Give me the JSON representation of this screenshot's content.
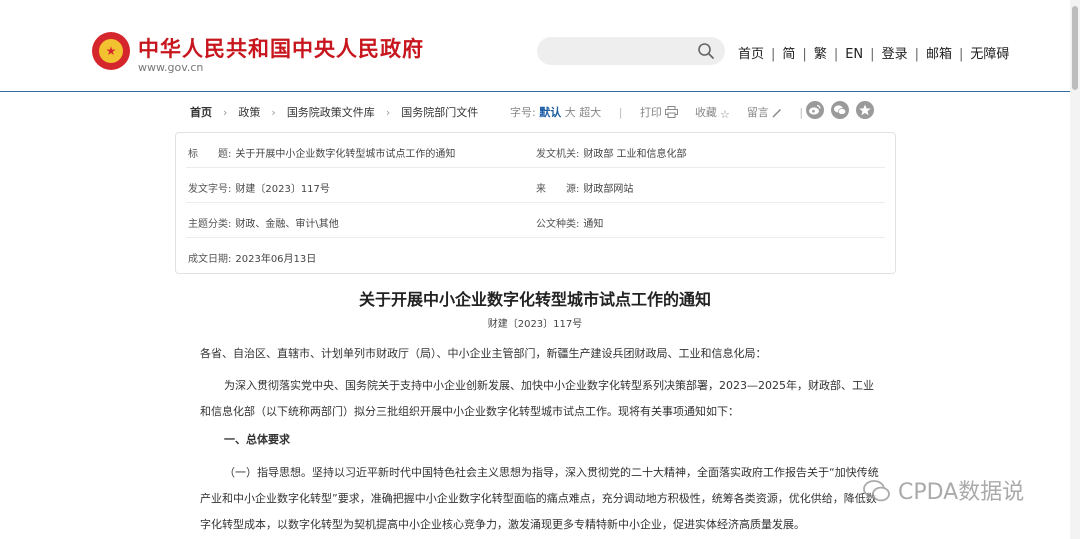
{
  "header": {
    "site_title": "中华人民共和国中央人民政府",
    "site_url": "www.gov.cn",
    "search": {
      "placeholder": ""
    },
    "nav": [
      "首页",
      "简",
      "繁",
      "EN",
      "登录",
      "邮箱",
      "无障碍"
    ],
    "accent_color": "#c8161e"
  },
  "breadcrumb": [
    "首页",
    "政策",
    "国务院政策文件库",
    "国务院部门文件"
  ],
  "tools": {
    "font_size_label": "字号:",
    "font_default": "默认",
    "font_large": "大",
    "font_xlarge": "超大",
    "print": "打印",
    "favorite": "收藏",
    "comment": "留言",
    "social_icons": [
      "weibo-icon",
      "wechat-icon",
      "favorite-star-icon"
    ]
  },
  "info": {
    "title_label": "标　　题:",
    "title_value": "关于开展中小企业数字化转型城市试点工作的通知",
    "issuer_label": "发文机关:",
    "issuer_value": "财政部 工业和信息化部",
    "docno_label": "发文字号:",
    "docno_value": "财建〔2023〕117号",
    "source_label": "来　　源:",
    "source_value": "财政部网站",
    "topic_label": "主题分类:",
    "topic_value": "财政、金融、审计\\其他",
    "type_label": "公文种类:",
    "type_value": "通知",
    "date_label": "成文日期:",
    "date_value": "2023年06月13日"
  },
  "article": {
    "title": "关于开展中小企业数字化转型城市试点工作的通知",
    "doc_no": "财建〔2023〕117号",
    "addressee": "各省、自治区、直辖市、计划单列市财政厅（局）、中小企业主管部门，新疆生产建设兵团财政局、工业和信息化局：",
    "intro": "为深入贯彻落实党中央、国务院关于支持中小企业创新发展、加快中小企业数字化转型系列决策部署，2023—2025年，财政部、工业和信息化部（以下统称两部门）拟分三批组织开展中小企业数字化转型城市试点工作。现将有关事项通知如下：",
    "section1": "一、总体要求",
    "para1": "（一）指导思想。坚持以习近平新时代中国特色社会主义思想为指导，深入贯彻党的二十大精神，全面落实政府工作报告关于“加快传统产业和中小企业数字化转型”要求，准确把握中小企业数字化转型面临的痛点难点，充分调动地方积极性，统筹各类资源，优化供给，降低数字化转型成本，以数字化转型为契机提高中小企业核心竞争力，激发涌现更多专精特新中小企业，促进实体经济高质量发展。"
  },
  "watermark": "CPDA数据说"
}
